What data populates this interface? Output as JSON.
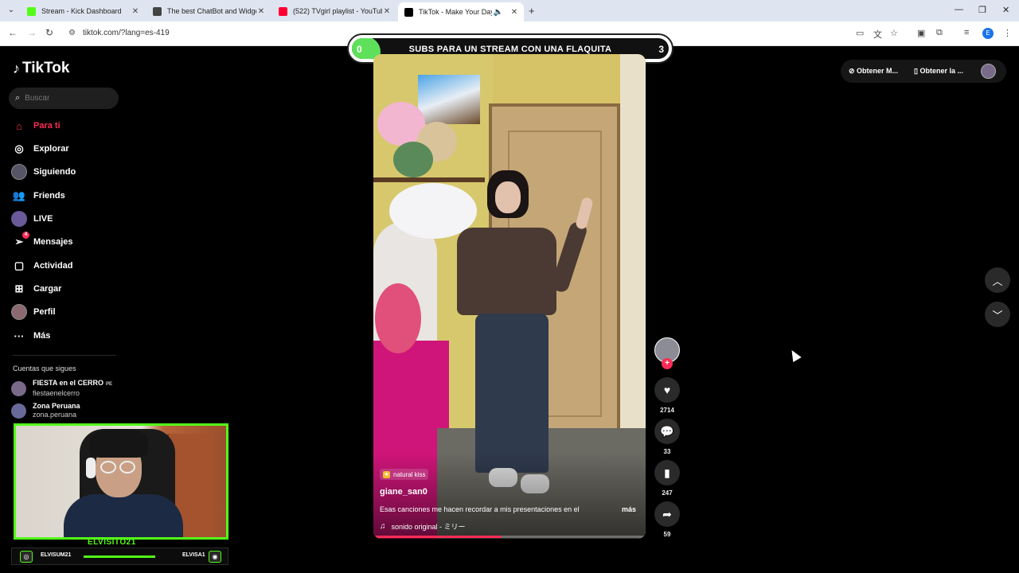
{
  "browser": {
    "tabs": [
      {
        "title": "Stream - Kick Dashboard",
        "color": "#53fc18"
      },
      {
        "title": "The best ChatBot and Widgets",
        "color": "#444444"
      },
      {
        "title": "(522) TVgirl playlist - YouTube",
        "color": "#ff0033"
      },
      {
        "title": "TikTok - Make Your Day",
        "color": "#000000"
      }
    ],
    "url": "tiktok.com/?lang=es-419",
    "profile_initial": "E"
  },
  "tiktok": {
    "logo": "TikTok",
    "search_placeholder": "Buscar",
    "nav": [
      {
        "label": "Para ti",
        "icon": "home-icon"
      },
      {
        "label": "Explorar",
        "icon": "compass-icon"
      },
      {
        "label": "Siguiendo",
        "icon": "following-icon"
      },
      {
        "label": "Friends",
        "icon": "friends-icon"
      },
      {
        "label": "LIVE",
        "icon": "live-icon"
      },
      {
        "label": "Mensajes",
        "icon": "messages-icon",
        "badge": "4"
      },
      {
        "label": "Actividad",
        "icon": "activity-icon"
      },
      {
        "label": "Cargar",
        "icon": "upload-icon"
      },
      {
        "label": "Perfil",
        "icon": "profile-icon"
      },
      {
        "label": "Más",
        "icon": "more-icon"
      }
    ],
    "following_heading": "Cuentas que sigues",
    "following": [
      {
        "name": "FIESTA en el CERRO",
        "tag": "PE",
        "username": "fiestaenelcerro"
      },
      {
        "name": "Zona Peruana",
        "username": "zona.peruana"
      }
    ],
    "top_right": {
      "btn1": "Obtener M...",
      "btn2": "Obtener la ..."
    }
  },
  "overlay": {
    "goal_current": "0",
    "goal_text": "SUBS PARA UN STREAM CON UNA FLAQUITA",
    "goal_target": "3",
    "streamer_name": "ELVISITO21",
    "instagram_handle": "ELVISUM21",
    "discord_handle": "ELVISA1"
  },
  "video": {
    "music_tag": "natural kiss",
    "username": "giane_san0",
    "description": "Esas canciones me hacen recordar a mis presentaciones en el",
    "more": "más",
    "sound": "sonido original - ミリー",
    "progress": 0.47
  },
  "actions": {
    "likes": "2714",
    "comments": "33",
    "saves": "247",
    "shares": "59"
  }
}
